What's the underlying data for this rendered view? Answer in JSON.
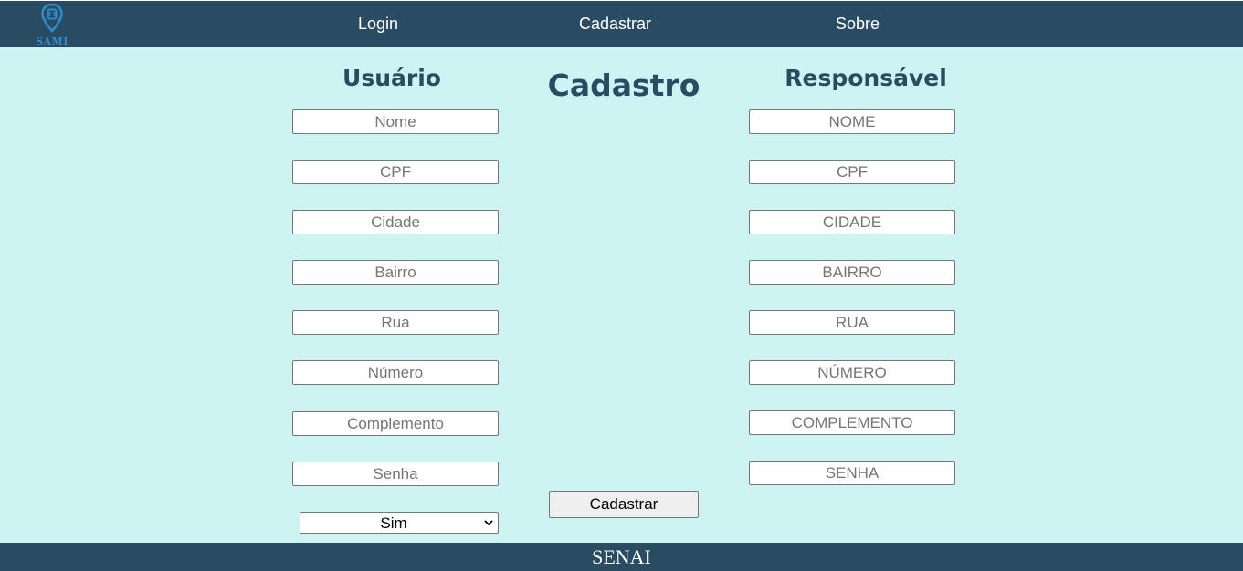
{
  "navbar": {
    "logo_text": "SAMI",
    "links": [
      {
        "label": "Login"
      },
      {
        "label": "Cadastrar"
      },
      {
        "label": "Sobre"
      }
    ]
  },
  "main": {
    "title": "Cadastro",
    "usuario": {
      "title": "Usuário",
      "fields": [
        {
          "placeholder": "Nome",
          "value": ""
        },
        {
          "placeholder": "CPF",
          "value": ""
        },
        {
          "placeholder": "Cidade",
          "value": ""
        },
        {
          "placeholder": "Bairro",
          "value": ""
        },
        {
          "placeholder": "Rua",
          "value": ""
        },
        {
          "placeholder": "Número",
          "value": ""
        },
        {
          "placeholder": "Complemento",
          "value": ""
        },
        {
          "placeholder": "Senha",
          "value": ""
        }
      ],
      "select": {
        "selected": "Sim"
      }
    },
    "responsavel": {
      "title": "Responsável",
      "fields": [
        {
          "placeholder": "NOME",
          "value": ""
        },
        {
          "placeholder": "CPF",
          "value": ""
        },
        {
          "placeholder": "CIDADE",
          "value": ""
        },
        {
          "placeholder": "BAIRRO",
          "value": ""
        },
        {
          "placeholder": "RUA",
          "value": ""
        },
        {
          "placeholder": "NÚMERO",
          "value": ""
        },
        {
          "placeholder": "COMPLEMENTO",
          "value": ""
        },
        {
          "placeholder": "SENHA",
          "value": ""
        }
      ]
    },
    "submit_label": "Cadastrar"
  },
  "footer": {
    "text": "SENAI"
  },
  "colors": {
    "header_bg": "#2a4c62",
    "page_bg": "#cdf4f3",
    "title": "#2a4c62",
    "logo": "#2c8ccc"
  },
  "icons": {
    "logo": "location-pin-icon",
    "select": "chevron-down-icon"
  }
}
